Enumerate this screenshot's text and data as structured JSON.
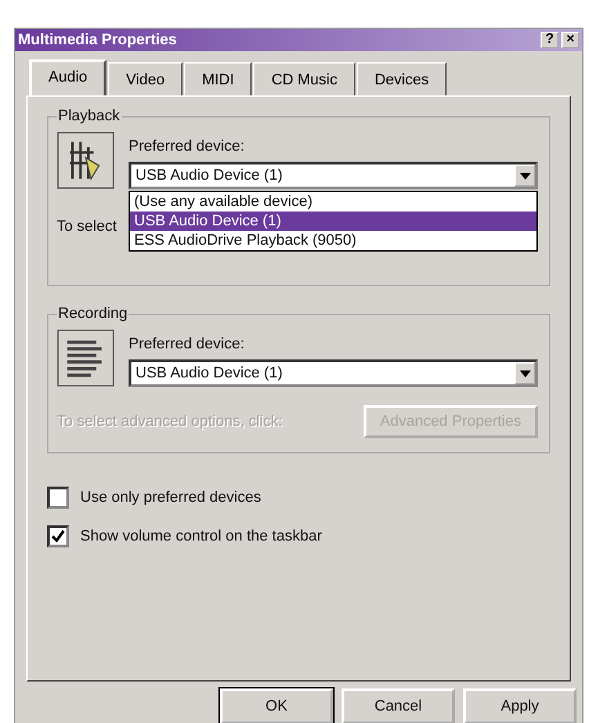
{
  "window": {
    "title": "Multimedia Properties",
    "help_button": "?",
    "close_button": "×"
  },
  "tabs": [
    {
      "label": "Audio",
      "selected": true
    },
    {
      "label": "Video",
      "selected": false
    },
    {
      "label": "MIDI",
      "selected": false
    },
    {
      "label": "CD Music",
      "selected": false
    },
    {
      "label": "Devices",
      "selected": false
    }
  ],
  "playback": {
    "group_label": "Playback",
    "device_label": "Preferred device:",
    "device_value": "USB Audio Device (1)",
    "hint": "To select",
    "dropdown_open": true,
    "dropdown_items": [
      {
        "label": "(Use any available device)",
        "selected": false
      },
      {
        "label": "USB Audio Device (1)",
        "selected": true
      },
      {
        "label": "ESS AudioDrive Playback (9050)",
        "selected": false
      }
    ]
  },
  "recording": {
    "group_label": "Recording",
    "device_label": "Preferred device:",
    "device_value": "USB Audio Device (1)",
    "hint": "To select advanced options, click:",
    "advanced_button": "Advanced Properties",
    "disabled": true
  },
  "checkboxes": [
    {
      "label": "Use only preferred devices",
      "checked": false
    },
    {
      "label": "Show volume control on the taskbar",
      "checked": true
    }
  ],
  "buttons": [
    "OK",
    "Cancel",
    "Apply"
  ]
}
